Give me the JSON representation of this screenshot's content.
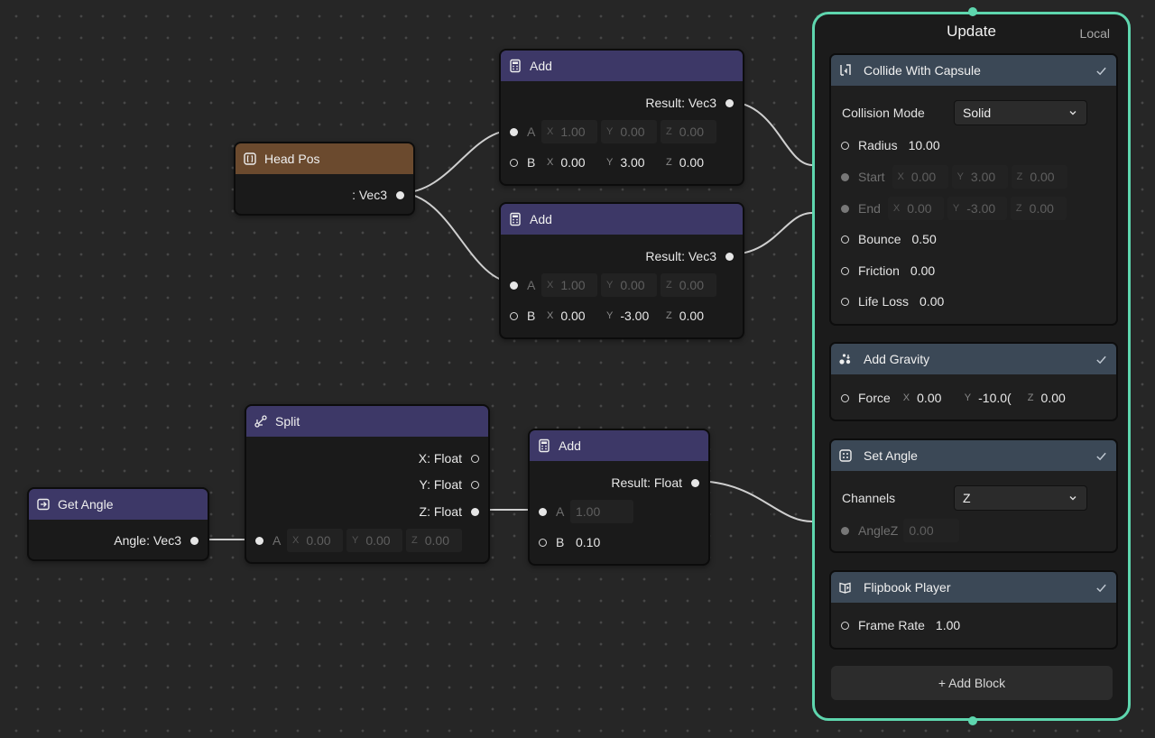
{
  "nodes": {
    "head_pos": {
      "title": "Head Pos",
      "output": ": Vec3"
    },
    "add1": {
      "title": "Add",
      "output": "Result: Vec3",
      "a": {
        "label": "A",
        "x": "1.00",
        "y": "0.00",
        "z": "0.00"
      },
      "b": {
        "label": "B",
        "x": "0.00",
        "y": "3.00",
        "z": "0.00"
      }
    },
    "add2": {
      "title": "Add",
      "output": "Result: Vec3",
      "a": {
        "label": "A",
        "x": "1.00",
        "y": "0.00",
        "z": "0.00"
      },
      "b": {
        "label": "B",
        "x": "0.00",
        "y": "-3.00",
        "z": "0.00"
      }
    },
    "get_angle": {
      "title": "Get Angle",
      "output": "Angle: Vec3"
    },
    "split": {
      "title": "Split",
      "out_x": "X: Float",
      "out_y": "Y: Float",
      "out_z": "Z: Float",
      "a": {
        "label": "A",
        "x": "0.00",
        "y": "0.00",
        "z": "0.00"
      }
    },
    "add3": {
      "title": "Add",
      "output": "Result: Float",
      "a": {
        "label": "A",
        "value": "1.00"
      },
      "b": {
        "label": "B",
        "value": "0.10"
      }
    }
  },
  "axes": {
    "x": "X",
    "y": "Y",
    "z": "Z"
  },
  "update": {
    "title": "Update",
    "space": "Local",
    "add_block_label": "+ Add Block",
    "blocks": {
      "collide": {
        "title": "Collide With Capsule",
        "mode_label": "Collision Mode",
        "mode_value": "Solid",
        "radius_label": "Radius",
        "radius": "10.00",
        "start_label": "Start",
        "start": {
          "x": "0.00",
          "y": "3.00",
          "z": "0.00"
        },
        "end_label": "End",
        "end": {
          "x": "0.00",
          "y": "-3.00",
          "z": "0.00"
        },
        "bounce_label": "Bounce",
        "bounce": "0.50",
        "friction_label": "Friction",
        "friction": "0.00",
        "lifeloss_label": "Life Loss",
        "lifeloss": "0.00"
      },
      "gravity": {
        "title": "Add Gravity",
        "force_label": "Force",
        "force": {
          "x": "0.00",
          "y": "-10.0(",
          "z": "0.00"
        }
      },
      "set_angle": {
        "title": "Set Angle",
        "channels_label": "Channels",
        "channels_value": "Z",
        "anglez_label": "AngleZ",
        "anglez": "0.00"
      },
      "flipbook": {
        "title": "Flipbook Player",
        "framerate_label": "Frame Rate",
        "framerate": "1.00"
      }
    }
  },
  "colors": {
    "accent": "#5ed6ae",
    "operator_header": "#3d3867",
    "property_header": "#6b4a2e",
    "block_header": "#3b4856",
    "canvas": "#262626"
  }
}
